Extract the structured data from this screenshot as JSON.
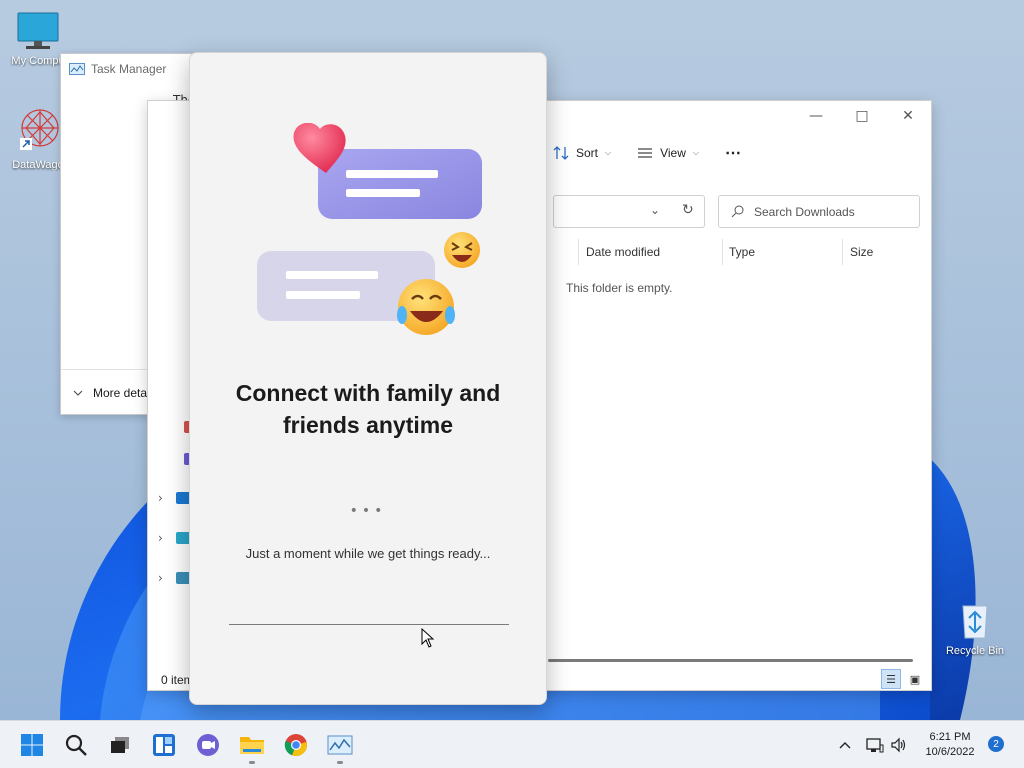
{
  "desktop": {
    "icons": [
      {
        "label": "My Compu"
      },
      {
        "label": "DataWago"
      },
      {
        "label": "Recycle Bin"
      }
    ]
  },
  "task_manager": {
    "title": "Task Manager",
    "body_text": "The",
    "more_details": "More details"
  },
  "explorer": {
    "toolbar": {
      "sort": "Sort",
      "view": "View",
      "more": "⋯"
    },
    "search_placeholder": "Search Downloads",
    "columns": [
      "Date modified",
      "Type",
      "Size"
    ],
    "empty_text": "This folder is empty.",
    "status": "0 item"
  },
  "teams_dialog": {
    "headline_line1": "Connect with family and",
    "headline_line2": "friends anytime",
    "dots": "•••",
    "loading_text": "Just a moment while we get things ready..."
  },
  "taskbar": {
    "time": "6:21 PM",
    "date": "10/6/2022",
    "notification_count": "2"
  }
}
